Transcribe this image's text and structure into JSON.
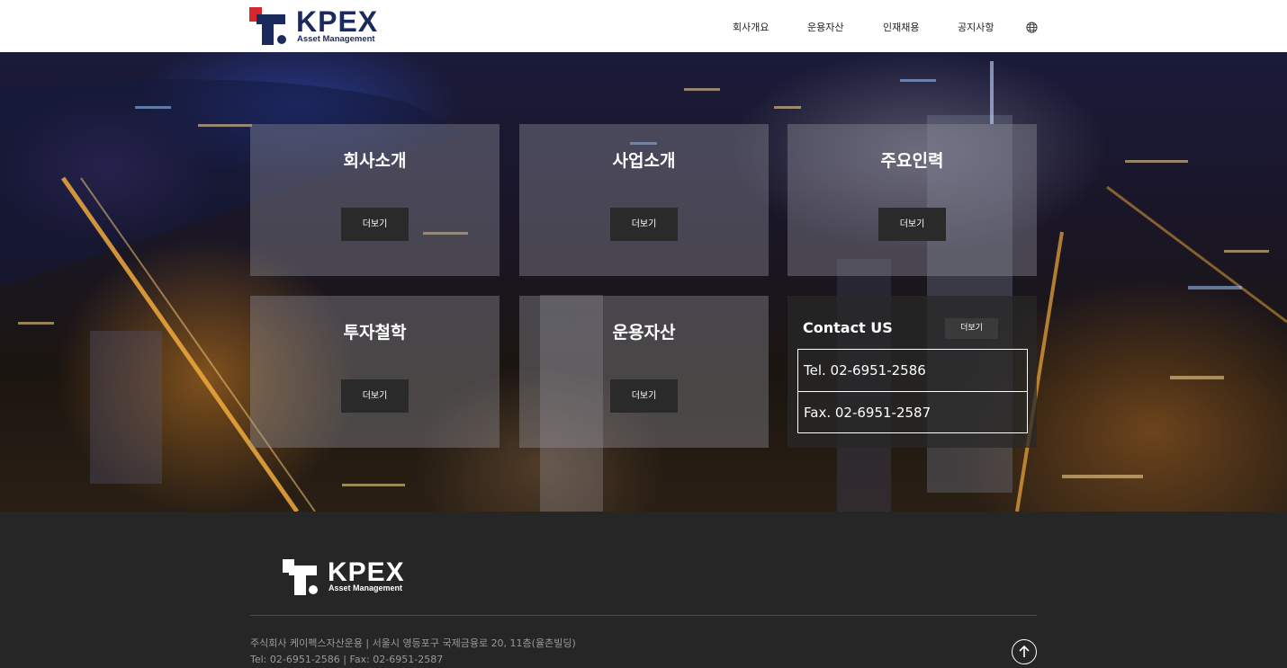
{
  "header": {
    "logo_text": "KPEX",
    "logo_sub": "Asset Management",
    "nav": [
      "회사개요",
      "운용자산",
      "인재채용",
      "공지사항"
    ],
    "globe_icon": "globe-icon"
  },
  "cards": [
    {
      "title": "회사소개",
      "button": "더보기"
    },
    {
      "title": "사업소개",
      "button": "더보기"
    },
    {
      "title": "주요인력",
      "button": "더보기"
    },
    {
      "title": "투자철학",
      "button": "더보기"
    },
    {
      "title": "운용자산",
      "button": "더보기"
    }
  ],
  "contact": {
    "title": "Contact US",
    "button": "더보기",
    "tel": "Tel. 02-6951-2586",
    "fax": "Fax. 02-6951-2587"
  },
  "footer": {
    "logo_text": "KPEX",
    "logo_sub": "Asset Management",
    "address": "주식회사 케이펙스자산운용 | 서울시 영등포구 국제금융로 20, 11층(율촌빌딩)",
    "phone": "Tel: 02-6951-2586 | Fax: 02-6951-2587",
    "top_icon": "arrow-up-icon"
  },
  "colors": {
    "brand_navy": "#1b2a5c",
    "brand_red": "#d8262e",
    "footer_bg": "#262626"
  }
}
